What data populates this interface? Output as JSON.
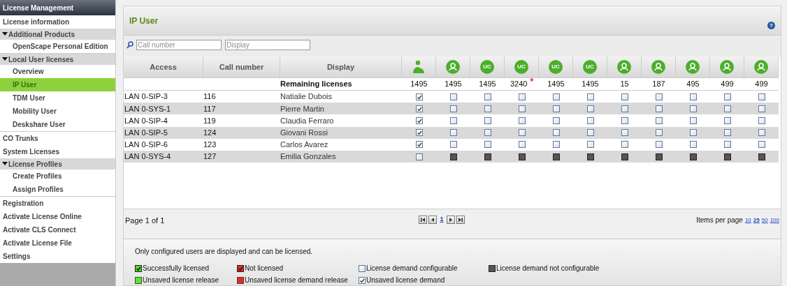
{
  "sidebar": {
    "title": "License Management",
    "items": [
      {
        "kind": "link",
        "label": "License information",
        "selected": false
      },
      {
        "kind": "group",
        "label": "Additional Products",
        "expanded": true,
        "children": [
          {
            "label": "OpenScape Personal Edition",
            "selected": false
          }
        ]
      },
      {
        "kind": "group",
        "label": "Local User licenses",
        "expanded": true,
        "children": [
          {
            "label": "Overview",
            "selected": false
          },
          {
            "label": "IP User",
            "selected": true
          },
          {
            "label": "TDM User",
            "selected": false
          },
          {
            "label": "Mobility User",
            "selected": false
          },
          {
            "label": "Deskshare User",
            "selected": false
          }
        ]
      },
      {
        "kind": "link",
        "label": "CO Trunks",
        "selected": false
      },
      {
        "kind": "link",
        "label": "System Licenses",
        "selected": false
      },
      {
        "kind": "group",
        "label": "License Profiles",
        "expanded": true,
        "children": [
          {
            "label": "Create Profiles",
            "selected": false
          },
          {
            "label": "Assign Profiles",
            "selected": false
          }
        ]
      },
      {
        "kind": "link",
        "label": "Registration",
        "selected": false
      },
      {
        "kind": "link",
        "label": "Activate License Online",
        "selected": false
      },
      {
        "kind": "link",
        "label": "Activate CLS Connect",
        "selected": false
      },
      {
        "kind": "link",
        "label": "Activate License File",
        "selected": false
      },
      {
        "kind": "link",
        "label": "Settings",
        "selected": false
      }
    ]
  },
  "panel": {
    "title": "IP User",
    "help": "?"
  },
  "filters": [
    {
      "placeholder": "Call number"
    },
    {
      "placeholder": "Display"
    }
  ],
  "table": {
    "columns": [
      "Access",
      "Call number",
      "Display"
    ],
    "license_columns": [
      {
        "kind": "person",
        "remaining": "1495"
      },
      {
        "kind": "circle",
        "remaining": "1495"
      },
      {
        "kind": "uc",
        "text": "UC",
        "remaining": "1495"
      },
      {
        "kind": "uc",
        "text": "UC",
        "remaining": "3240",
        "flag": "*"
      },
      {
        "kind": "uc",
        "text": "UC",
        "remaining": "1495"
      },
      {
        "kind": "uc",
        "text": "UC",
        "remaining": "1495"
      },
      {
        "kind": "circle",
        "remaining": "15"
      },
      {
        "kind": "circle",
        "remaining": "187"
      },
      {
        "kind": "circle",
        "remaining": "495"
      },
      {
        "kind": "circle",
        "remaining": "499"
      },
      {
        "kind": "circle",
        "remaining": "499"
      }
    ],
    "remaining_label": "Remaining licenses",
    "rows": [
      {
        "access": "LAN 0-SIP-3",
        "call_number": "116",
        "display": "Natialie Dubois",
        "licenses": [
          {
            "checked": true,
            "configurable": true
          },
          {
            "checked": false,
            "configurable": true
          },
          {
            "checked": false,
            "configurable": true
          },
          {
            "checked": false,
            "configurable": true
          },
          {
            "checked": false,
            "configurable": true
          },
          {
            "checked": false,
            "configurable": true
          },
          {
            "checked": false,
            "configurable": true
          },
          {
            "checked": false,
            "configurable": true
          },
          {
            "checked": false,
            "configurable": true
          },
          {
            "checked": false,
            "configurable": true
          },
          {
            "checked": false,
            "configurable": true
          }
        ]
      },
      {
        "access": "LAN 0-SYS-1",
        "call_number": "117",
        "display": "Pierre Martin",
        "licenses": [
          {
            "checked": true,
            "configurable": true
          },
          {
            "checked": false,
            "configurable": true
          },
          {
            "checked": false,
            "configurable": true
          },
          {
            "checked": false,
            "configurable": true
          },
          {
            "checked": false,
            "configurable": true
          },
          {
            "checked": false,
            "configurable": true
          },
          {
            "checked": false,
            "configurable": true
          },
          {
            "checked": false,
            "configurable": true
          },
          {
            "checked": false,
            "configurable": true
          },
          {
            "checked": false,
            "configurable": true
          },
          {
            "checked": false,
            "configurable": true
          }
        ]
      },
      {
        "access": "LAN 0-SIP-4",
        "call_number": "119",
        "display": "Claudia Ferraro",
        "licenses": [
          {
            "checked": true,
            "configurable": true
          },
          {
            "checked": false,
            "configurable": true
          },
          {
            "checked": false,
            "configurable": true
          },
          {
            "checked": false,
            "configurable": true
          },
          {
            "checked": false,
            "configurable": true
          },
          {
            "checked": false,
            "configurable": true
          },
          {
            "checked": false,
            "configurable": true
          },
          {
            "checked": false,
            "configurable": true
          },
          {
            "checked": false,
            "configurable": true
          },
          {
            "checked": false,
            "configurable": true
          },
          {
            "checked": false,
            "configurable": true
          }
        ]
      },
      {
        "access": "LAN 0-SIP-5",
        "call_number": "124",
        "display": "Giovani Rossi",
        "licenses": [
          {
            "checked": true,
            "configurable": true
          },
          {
            "checked": false,
            "configurable": true
          },
          {
            "checked": false,
            "configurable": true
          },
          {
            "checked": false,
            "configurable": true
          },
          {
            "checked": false,
            "configurable": true
          },
          {
            "checked": false,
            "configurable": true
          },
          {
            "checked": false,
            "configurable": true
          },
          {
            "checked": false,
            "configurable": true
          },
          {
            "checked": false,
            "configurable": true
          },
          {
            "checked": false,
            "configurable": true
          },
          {
            "checked": false,
            "configurable": true
          }
        ]
      },
      {
        "access": "LAN 0-SIP-6",
        "call_number": "123",
        "display": "Carlos Avarez",
        "licenses": [
          {
            "checked": true,
            "configurable": true
          },
          {
            "checked": false,
            "configurable": true
          },
          {
            "checked": false,
            "configurable": true
          },
          {
            "checked": false,
            "configurable": true
          },
          {
            "checked": false,
            "configurable": true
          },
          {
            "checked": false,
            "configurable": true
          },
          {
            "checked": false,
            "configurable": true
          },
          {
            "checked": false,
            "configurable": true
          },
          {
            "checked": false,
            "configurable": true
          },
          {
            "checked": false,
            "configurable": true
          },
          {
            "checked": false,
            "configurable": true
          }
        ]
      },
      {
        "access": "LAN 0-SYS-4",
        "call_number": "127",
        "display": "Emilia Gonzales",
        "licenses": [
          {
            "checked": false,
            "configurable": true
          },
          {
            "configurable": false
          },
          {
            "configurable": false
          },
          {
            "configurable": false
          },
          {
            "configurable": false
          },
          {
            "configurable": false
          },
          {
            "configurable": false
          },
          {
            "configurable": false
          },
          {
            "configurable": false
          },
          {
            "configurable": false
          },
          {
            "configurable": false
          }
        ]
      }
    ]
  },
  "pagination": {
    "summary": "Page 1 of 1",
    "pages": [
      {
        "label": "1",
        "selected": true
      }
    ],
    "items_per_page_label": "Items per page",
    "sizes": [
      {
        "label": "10",
        "selected": false
      },
      {
        "label": "25",
        "selected": true
      },
      {
        "label": "50",
        "selected": false
      },
      {
        "label": "100",
        "selected": false
      }
    ]
  },
  "note": "Only configured users are displayed and can be licensed.",
  "legend": [
    {
      "kind": "licensed",
      "label": "Successfully licensed"
    },
    {
      "kind": "not_licensed",
      "label": "Not licensed"
    },
    {
      "kind": "open",
      "label": "License demand configurable"
    },
    {
      "kind": "locked",
      "label": "License demand not configurable"
    },
    {
      "kind": "release",
      "label": "Unsaved license release"
    },
    {
      "kind": "demand_release",
      "label": "Unsaved license demand release"
    },
    {
      "kind": "checked",
      "label": "Unsaved license demand"
    }
  ]
}
